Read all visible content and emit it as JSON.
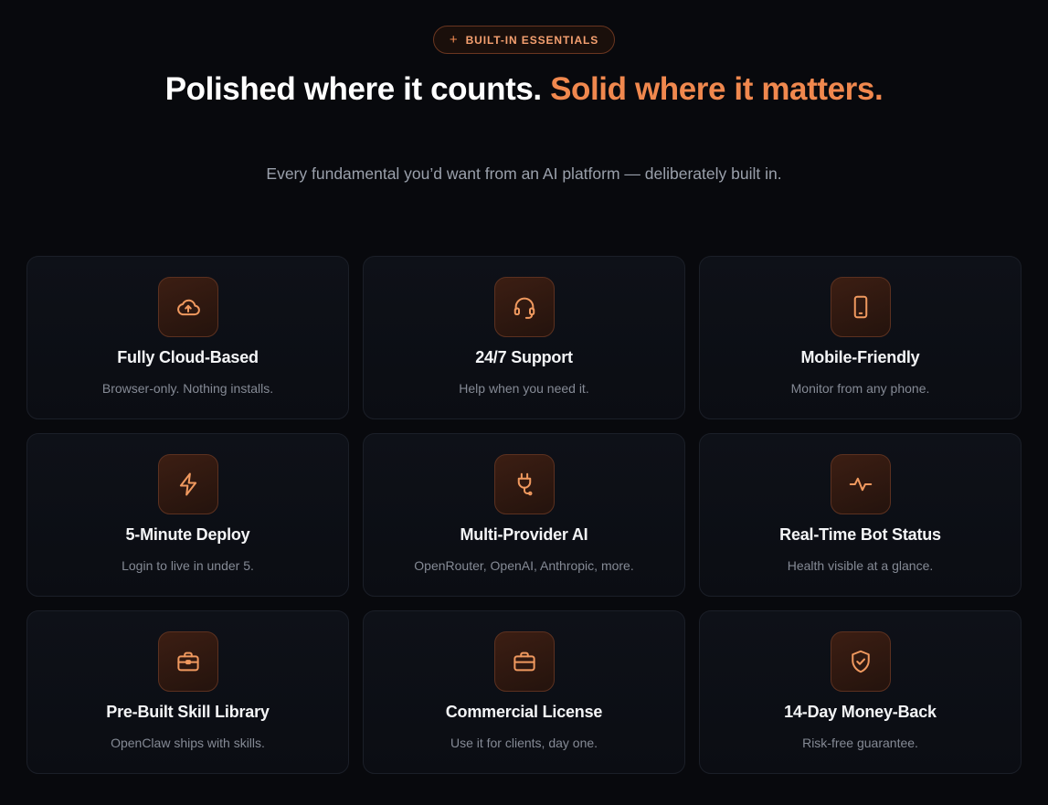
{
  "eyebrow": {
    "icon": "plus-icon",
    "label": "BUILT-IN ESSENTIALS"
  },
  "headline": {
    "white": "Polished where it counts.",
    "accent": "Solid where it matters."
  },
  "subhead": "Every fundamental you’d want from an AI platform — deliberately built in.",
  "colors": {
    "accent": "#f0884e",
    "background": "#08090d",
    "card": "#0e1118"
  },
  "features": [
    {
      "icon": "cloud-upload-icon",
      "title": "Fully Cloud-Based",
      "desc": "Browser-only. Nothing installs."
    },
    {
      "icon": "headset-icon",
      "title": "24/7 Support",
      "desc": "Help when you need it."
    },
    {
      "icon": "smartphone-icon",
      "title": "Mobile-Friendly",
      "desc": "Monitor from any phone."
    },
    {
      "icon": "lightning-icon",
      "title": "5-Minute Deploy",
      "desc": "Login to live in under 5."
    },
    {
      "icon": "plug-icon",
      "title": "Multi-Provider AI",
      "desc": "OpenRouter, OpenAI, Anthropic, more."
    },
    {
      "icon": "activity-icon",
      "title": "Real-Time Bot Status",
      "desc": "Health visible at a glance."
    },
    {
      "icon": "briefcase-icon",
      "title": "Pre-Built Skill Library",
      "desc": "OpenClaw ships with skills."
    },
    {
      "icon": "briefcase-icon",
      "title": "Commercial License",
      "desc": "Use it for clients, day one."
    },
    {
      "icon": "shield-check-icon",
      "title": "14-Day Money-Back",
      "desc": "Risk-free guarantee."
    }
  ]
}
